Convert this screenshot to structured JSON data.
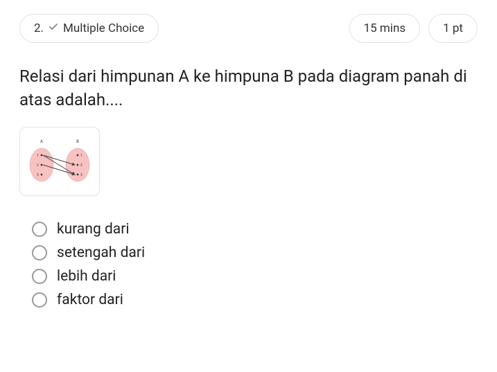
{
  "header": {
    "question_number": "2.",
    "question_type": "Multiple Choice",
    "time": "15 mins",
    "points": "1 pt"
  },
  "question": {
    "text": "Relasi dari himpunan A ke himpuna B pada diagram panah di atas adalah...."
  },
  "diagram": {
    "set_a_label": "A",
    "set_b_label": "B",
    "set_a": [
      "1",
      "2",
      "3"
    ],
    "set_b": [
      "1",
      "2",
      "3"
    ]
  },
  "options": [
    {
      "label": "kurang dari"
    },
    {
      "label": "setengah dari"
    },
    {
      "label": "lebih dari"
    },
    {
      "label": "faktor dari"
    }
  ]
}
